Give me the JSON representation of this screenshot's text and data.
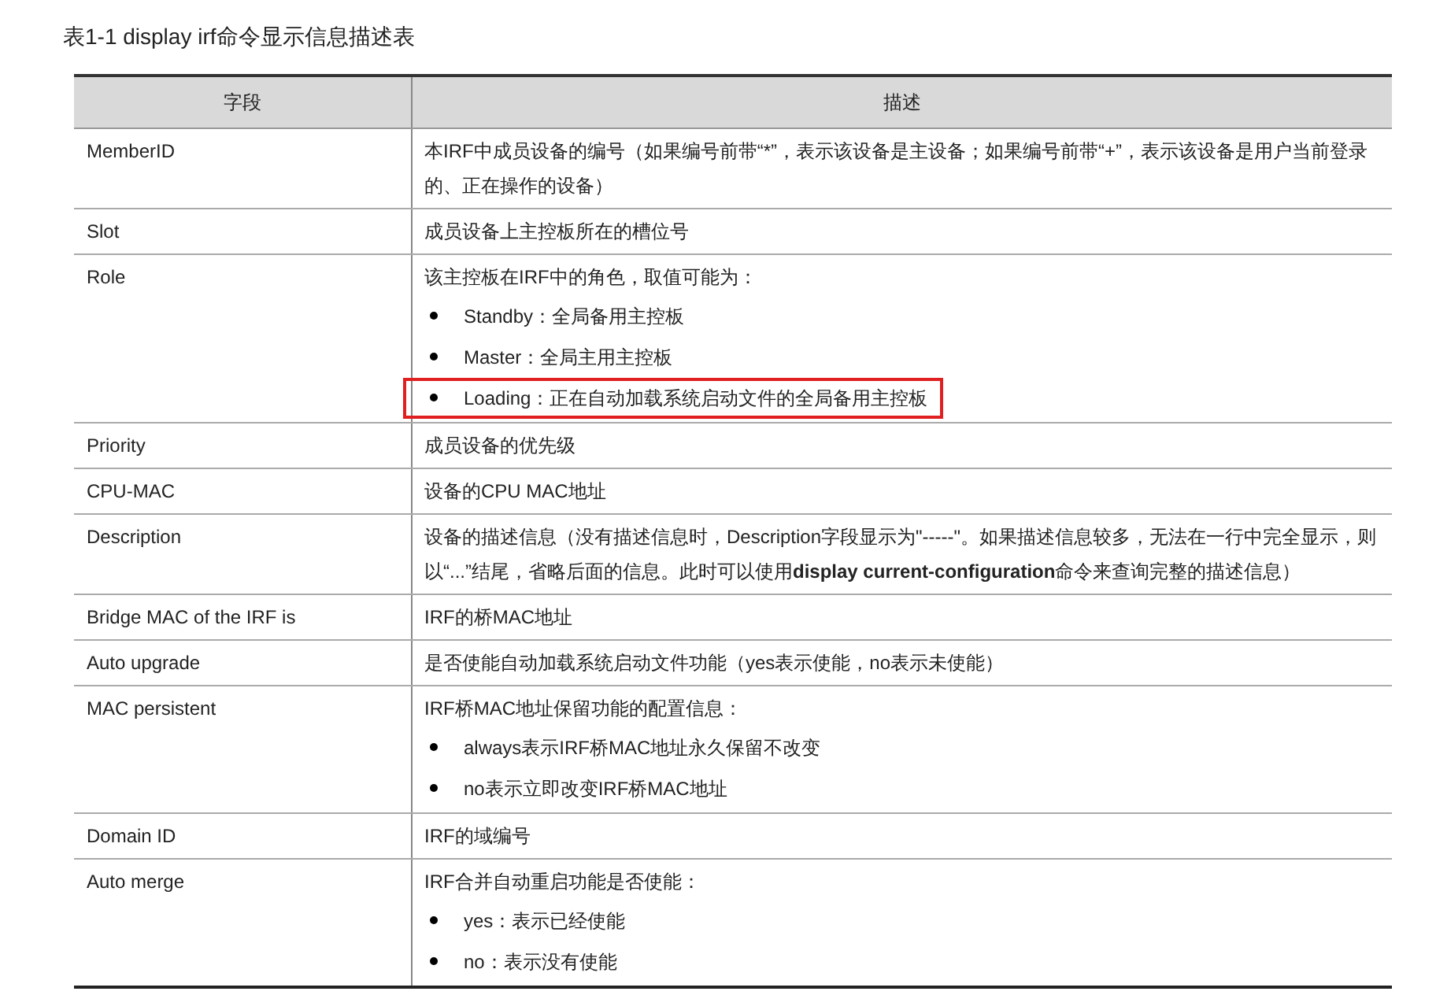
{
  "caption": "表1-1 display irf命令显示信息描述表",
  "table": {
    "columns": [
      "字段",
      "描述"
    ],
    "rows": [
      {
        "field": "MemberID",
        "content": [
          {
            "kind": "text",
            "text": "本IRF中成员设备的编号（如果编号前带“*”，表示该设备是主设备；如果编号前带“+”，表示该设备是用户当前登录的、正在操作的设备）"
          }
        ]
      },
      {
        "field": "Slot",
        "content": [
          {
            "kind": "text",
            "text": "成员设备上主控板所在的槽位号"
          }
        ]
      },
      {
        "field": "Role",
        "content": [
          {
            "kind": "text",
            "text": "该主控板在IRF中的角色，取值可能为："
          },
          {
            "kind": "bullet",
            "text": "Standby：全局备用主控板",
            "highlighted": false
          },
          {
            "kind": "bullet",
            "text": "Master：全局主用主控板",
            "highlighted": false
          },
          {
            "kind": "bullet",
            "text": "Loading：正在自动加载系统启动文件的全局备用主控板",
            "highlighted": true
          }
        ]
      },
      {
        "field": "Priority",
        "content": [
          {
            "kind": "text",
            "text": "成员设备的优先级"
          }
        ]
      },
      {
        "field": "CPU-MAC",
        "content": [
          {
            "kind": "text",
            "text": "设备的CPU MAC地址"
          }
        ]
      },
      {
        "field": "Description",
        "content": [
          {
            "kind": "text",
            "text": "设备的描述信息（没有描述信息时，Description字段显示为\"-----\"。如果描述信息较多，无法在一行中完全显示，则以“...”结尾，省略后面的信息。此时可以使用**display current-configuration**命令来查询完整的描述信息）"
          }
        ]
      },
      {
        "field": "Bridge MAC of the IRF is",
        "content": [
          {
            "kind": "text",
            "text": "IRF的桥MAC地址"
          }
        ]
      },
      {
        "field": "Auto upgrade",
        "content": [
          {
            "kind": "text",
            "text": "是否使能自动加载系统启动文件功能（yes表示使能，no表示未使能）"
          }
        ]
      },
      {
        "field": "MAC persistent",
        "content": [
          {
            "kind": "text",
            "text": "IRF桥MAC地址保留功能的配置信息："
          },
          {
            "kind": "bullet",
            "text": "always表示IRF桥MAC地址永久保留不改变",
            "highlighted": false
          },
          {
            "kind": "bullet",
            "text": "no表示立即改变IRF桥MAC地址",
            "highlighted": false
          }
        ]
      },
      {
        "field": "Domain ID",
        "content": [
          {
            "kind": "text",
            "text": "IRF的域编号"
          }
        ]
      },
      {
        "field": "Auto merge",
        "content": [
          {
            "kind": "text",
            "text": "IRF合并自动重启功能是否使能："
          },
          {
            "kind": "bullet",
            "text": "yes：表示已经使能",
            "highlighted": false
          },
          {
            "kind": "bullet",
            "text": "no：表示没有使能",
            "highlighted": false
          }
        ]
      }
    ]
  }
}
